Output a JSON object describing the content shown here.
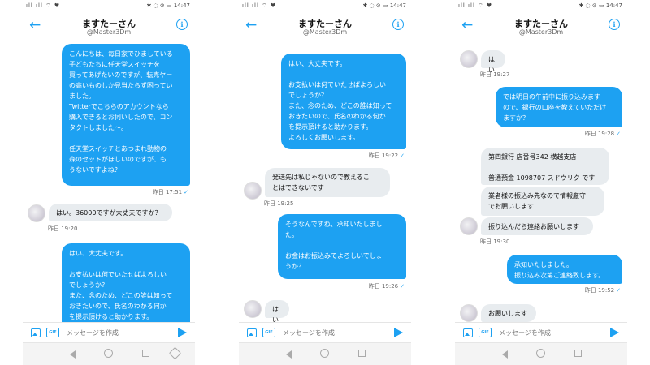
{
  "accent_color": "#1da1f2",
  "status_bar": {
    "left_icons": "ıll ıll ⌔ ♥",
    "right_icons": "✱ ◌ ⊘ ▭",
    "time": "14:47"
  },
  "header": {
    "title": "ますたーさん",
    "handle": "@Master3Dm"
  },
  "composer": {
    "placeholder": "メッセージを作成",
    "gif_label": "GIF"
  },
  "screens": [
    {
      "messages": [
        {
          "text": "こんにちは、毎日家でひましている\n子どもたちに任天堂スイッチを\n買ってあげたいのですが、転売ヤー\nの高いものしか見当たらず困ってい\nました。\nTwitterでこちらのアカウントなら\n購入できるとお伺いしたので、コン\nタクトしました〜。\n\n任天堂スイッチとあつまれ動物の\n森のセットがほしいのですが、も\nうないですよね？"
        },
        {
          "text": "はい。36000ですが大丈夫ですか？"
        },
        {
          "text": "はい、大丈夫です。\n\nお支払いは何でいたせばよろしい\nでしょうか？\nまた、念のため、どこの誰は知って\nおきたいので、氏名のわかる何か\nを提示頂けると助かります。"
        }
      ],
      "timestamps": [
        {
          "text": "昨日 17:51",
          "check": "✓"
        },
        {
          "text": "昨日 19:20"
        }
      ]
    },
    {
      "messages": [
        {
          "text": "はい、大丈夫です。\n\nお支払いは何でいたせばよろしい\nでしょうか？\nまた、念のため、どこの誰は知って\nおきたいので、氏名のわかる何か\nを提示頂けると助かります。\nよろしくお願いします。"
        },
        {
          "text": "発送先は私じゃないので教えるこ\nとはできないです"
        },
        {
          "text": "そうなんですね、承知いたしまし\nた。\n\nお金はお振込みでよろしいでしょ\nうか？"
        },
        {
          "text": "はい"
        }
      ],
      "timestamps": [
        {
          "text": "昨日 19:22",
          "check": "✓"
        },
        {
          "text": "昨日 19:25"
        },
        {
          "text": "昨日 19:26",
          "check": "✓"
        }
      ]
    },
    {
      "messages": [
        {
          "text": "はい"
        },
        {
          "text": "では明日の午前中に振り込みます\nので、銀行の口座を教えていただけ\nますか？"
        },
        {
          "text": "第四銀行 店番号342 横越支店\n\n普通預金 1098707 スドウリク です"
        },
        {
          "text": "業者様の振込み先なので情報厳守\nでお願いします"
        },
        {
          "text": "振り込んだら連絡お願いします"
        },
        {
          "text": "承知いたしました。\n振り込み次第ご連絡致します。"
        },
        {
          "text": "お願いします"
        }
      ],
      "timestamps": [
        {
          "text": "昨日 19:27"
        },
        {
          "text": "昨日 19:28",
          "check": "✓"
        },
        {
          "text": "昨日 19:30"
        },
        {
          "text": "昨日 19:52",
          "check": "✓"
        }
      ]
    }
  ]
}
